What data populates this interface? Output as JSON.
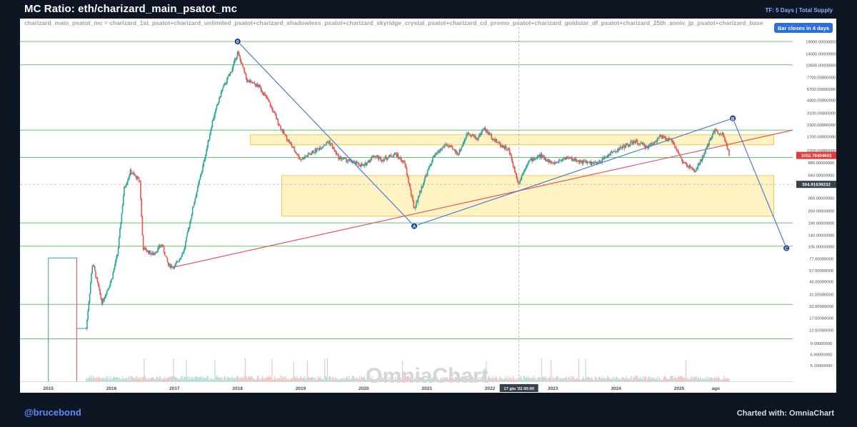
{
  "header": {
    "title": "MC Ratio: eth/charizard_main_psatot_mc",
    "timeframe": "TF: 5 Days | Total Supply",
    "formula": "charizard_main_psatot_mc = charizard_1st_psatot+charizard_unlimited_psatot+charizard_shadowless_psatot+charizard_skyridge_crystal_psatot+charizard_cd_promo_psatot+charizard_goldstar_df_psatot+charizard_25th_anniv_jp_psatot+charizard_base",
    "bar_close_badge": "Bar closes in 4 days"
  },
  "footer": {
    "handle": "@brucebond",
    "credit": "Charted with: OmniaChart"
  },
  "watermark": "OmniaChart",
  "colors": {
    "background": "#0f1623",
    "plot_bg": "#ffffff",
    "up_candle": "#26a69a",
    "down_candle": "#ef5350",
    "horizontal_level": "#6cc26c",
    "zone_fill": "#fff3c4",
    "zone_stroke": "#f2c94c",
    "wave_line": "#4c7bd6",
    "trend_line": "#e05a5a",
    "price_tag": "#e53935",
    "crosshair_tag": "#37414f"
  },
  "chart_data": {
    "type": "candlestick",
    "y_scale": "log",
    "ylim": [
      3.4,
      34000
    ],
    "xlim": [
      2014.55,
      2026.8
    ],
    "y_ticks": [
      "19000.00000000",
      "14000.00000000",
      "10500.00000000",
      "7700.00000000",
      "5700.00000000",
      "4300.00000000",
      "3100.00000000",
      "2300.00000000",
      "1700.00000000",
      "1200.00000000",
      "880.00000000",
      "640.00000000",
      "360.00000000",
      "260.00000000",
      "190.00000000",
      "140.00000000",
      "105.00000000",
      "77.00000000",
      "57.00000000",
      "43.00000000",
      "31.00000000",
      "23.00000000",
      "17.00000000",
      "12.50000000",
      "9.00000000",
      "6.80000000",
      "5.10000000"
    ],
    "y_tick_values": [
      19000,
      14000,
      10500,
      7700,
      5700,
      4300,
      3100,
      2300,
      1700,
      1200,
      880,
      640,
      360,
      260,
      190,
      140,
      105,
      77,
      57,
      43,
      31,
      23,
      17,
      12.5,
      9,
      6.8,
      5.1
    ],
    "x_ticks": [
      "2015",
      "2016",
      "2017",
      "2018",
      "2019",
      "2020",
      "2021",
      "2022",
      "2023",
      "2024",
      "2025",
      "ago"
    ],
    "x_tick_values": [
      2015.0,
      2016.0,
      2017.0,
      2018.0,
      2019.0,
      2020.0,
      2021.0,
      2022.0,
      2023.0,
      2024.0,
      2025.0,
      2025.58
    ],
    "current_price": {
      "label": "1052.78404603",
      "value": 1052.78
    },
    "crosshair": {
      "price_label": "504.91639232",
      "price": 504.92,
      "time_label": "17 giu '22   00:00",
      "time": 2022.46
    },
    "horizontal_levels": [
      19000,
      10500,
      2000,
      1000,
      190,
      105,
      24,
      10
    ],
    "zones": [
      {
        "x0": 2018.2,
        "x1": 2026.5,
        "y0": 1380,
        "y1": 1780
      },
      {
        "x0": 2018.7,
        "x1": 2026.5,
        "y0": 225,
        "y1": 630
      }
    ],
    "wave_points": [
      {
        "label": "0",
        "x": 2018.0,
        "y": 19000
      },
      {
        "label": "A",
        "x": 2020.8,
        "y": 175
      },
      {
        "label": "B",
        "x": 2025.85,
        "y": 2700
      },
      {
        "label": "C",
        "x": 2026.7,
        "y": 100
      }
    ],
    "trend_line": {
      "x0": 2017.0,
      "y0": 62,
      "x1": 2026.8,
      "y1": 2000
    },
    "price_path": [
      [
        2015.0,
        78
      ],
      [
        2015.45,
        78
      ],
      [
        2015.5,
        13
      ],
      [
        2015.6,
        13
      ],
      [
        2015.7,
        70
      ],
      [
        2015.85,
        25
      ],
      [
        2016.0,
        45
      ],
      [
        2016.1,
        90
      ],
      [
        2016.2,
        450
      ],
      [
        2016.3,
        700
      ],
      [
        2016.45,
        550
      ],
      [
        2016.5,
        100
      ],
      [
        2016.65,
        85
      ],
      [
        2016.8,
        110
      ],
      [
        2016.9,
        65
      ],
      [
        2017.0,
        62
      ],
      [
        2017.15,
        95
      ],
      [
        2017.3,
        300
      ],
      [
        2017.45,
        800
      ],
      [
        2017.6,
        2500
      ],
      [
        2017.75,
        5500
      ],
      [
        2017.9,
        9000
      ],
      [
        2018.0,
        14500
      ],
      [
        2018.15,
        7000
      ],
      [
        2018.35,
        6000
      ],
      [
        2018.5,
        4000
      ],
      [
        2018.7,
        2000
      ],
      [
        2018.9,
        1200
      ],
      [
        2019.0,
        950
      ],
      [
        2019.2,
        1150
      ],
      [
        2019.45,
        1500
      ],
      [
        2019.6,
        1000
      ],
      [
        2019.8,
        900
      ],
      [
        2020.0,
        800
      ],
      [
        2020.15,
        1050
      ],
      [
        2020.3,
        950
      ],
      [
        2020.5,
        1100
      ],
      [
        2020.65,
        850
      ],
      [
        2020.8,
        270
      ],
      [
        2020.95,
        550
      ],
      [
        2021.1,
        1000
      ],
      [
        2021.3,
        1400
      ],
      [
        2021.5,
        1100
      ],
      [
        2021.65,
        1900
      ],
      [
        2021.8,
        1600
      ],
      [
        2021.9,
        2100
      ],
      [
        2022.1,
        1500
      ],
      [
        2022.3,
        1200
      ],
      [
        2022.45,
        520
      ],
      [
        2022.6,
        900
      ],
      [
        2022.8,
        1050
      ],
      [
        2023.0,
        850
      ],
      [
        2023.2,
        1000
      ],
      [
        2023.45,
        900
      ],
      [
        2023.7,
        850
      ],
      [
        2023.9,
        1100
      ],
      [
        2024.1,
        1300
      ],
      [
        2024.3,
        1500
      ],
      [
        2024.5,
        1300
      ],
      [
        2024.7,
        1700
      ],
      [
        2024.9,
        1500
      ],
      [
        2025.05,
        900
      ],
      [
        2025.25,
        700
      ],
      [
        2025.4,
        1100
      ],
      [
        2025.55,
        2000
      ],
      [
        2025.7,
        1800
      ],
      [
        2025.8,
        1052.78
      ]
    ]
  }
}
